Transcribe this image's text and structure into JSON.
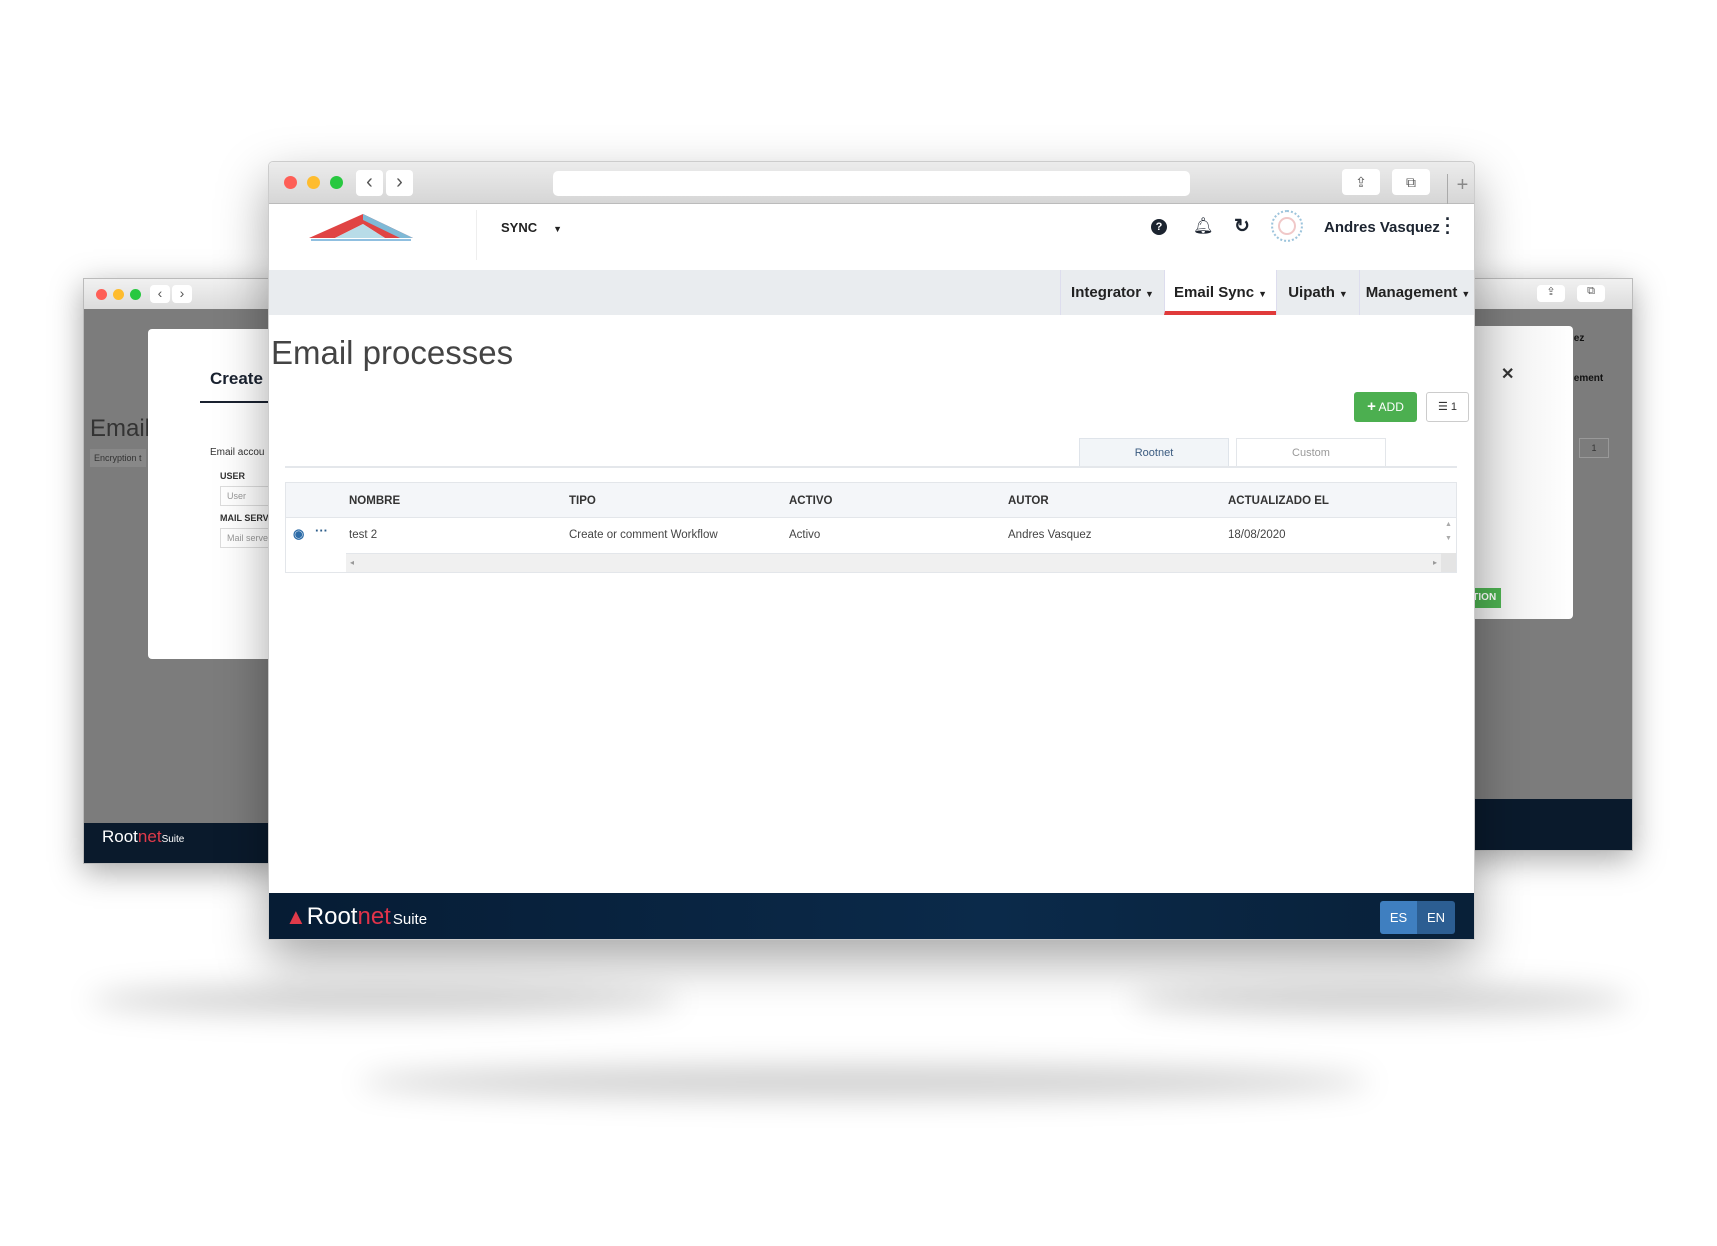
{
  "browser": {
    "back_icon": "chevron-left-icon",
    "forward_icon": "chevron-right-icon",
    "share_icon": "share-icon",
    "tabs_icon": "tabs-icon",
    "new_tab_icon": "plus-icon"
  },
  "header": {
    "app_select": "SYNC",
    "user_name": "Andres Vasquez",
    "icons": [
      "help-icon",
      "bell-icon",
      "refresh-icon",
      "avatar",
      "kebab-icon"
    ]
  },
  "nav": {
    "items": [
      {
        "label": "Integrator"
      },
      {
        "label": "Email Sync",
        "active": true
      },
      {
        "label": "Uipath"
      },
      {
        "label": "Management"
      }
    ],
    "accent": "#e03a3a"
  },
  "main": {
    "title": "Email processes",
    "add_label": "ADD",
    "columns_count": "1",
    "add_color": "#4caf50",
    "tabs": [
      {
        "label": "Rootnet",
        "active": true
      },
      {
        "label": "Custom"
      }
    ],
    "table": {
      "columns": [
        "NOMBRE",
        "TIPO",
        "ACTIVO",
        "AUTOR",
        "ACTUALIZADO EL"
      ],
      "rows": [
        [
          "test 2",
          "Create or comment Workflow",
          "Activo",
          "Andres Vasquez",
          "18/08/2020"
        ]
      ]
    }
  },
  "footer": {
    "brand_root": "Root",
    "brand_net": "net",
    "brand_suite": "Suite",
    "languages": [
      "ES",
      "EN"
    ]
  },
  "background_left": {
    "page_title": "Email",
    "dialog_title": "Create e",
    "section_label": "Email accou",
    "user_label": "USER",
    "user_placeholder": "User",
    "mail_label": "MAIL SERVI",
    "mail_placeholder": "Mail serve",
    "encryption": "Encryption t",
    "brand_root": "Root",
    "brand_net": "net",
    "brand_suite": "Suite"
  },
  "background_right": {
    "user_partial": "squez",
    "nav_partial": "nagement",
    "save_partial": "ATION",
    "count": "1"
  }
}
